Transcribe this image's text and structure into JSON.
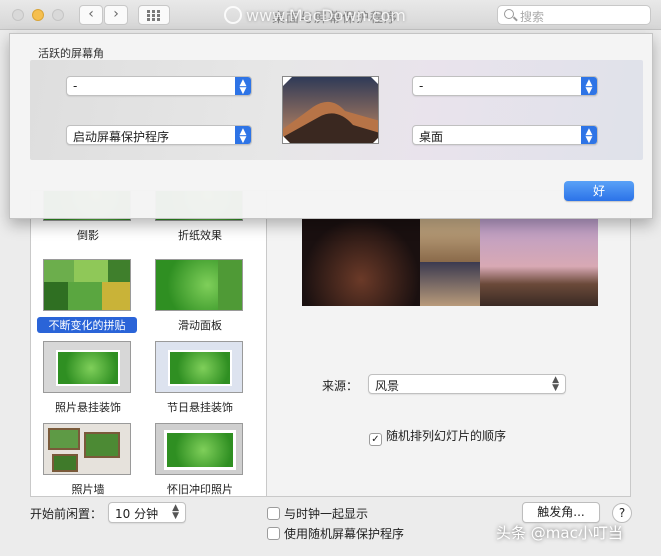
{
  "window": {
    "title": "桌面与屏幕保护程序",
    "search_placeholder": "搜索"
  },
  "watermark": "www.MacDown.com",
  "hot_corners": {
    "title": "活跃的屏幕角",
    "top_left": "-",
    "top_right": "-",
    "bottom_left": "启动屏幕保护程序",
    "bottom_right": "桌面",
    "ok_label": "好"
  },
  "screensavers": [
    {
      "name": "倒影",
      "selected": false
    },
    {
      "name": "折纸效果",
      "selected": false
    },
    {
      "name": "不断变化的拼贴",
      "selected": true
    },
    {
      "name": "滑动面板",
      "selected": false
    },
    {
      "name": "照片悬挂装饰",
      "selected": false
    },
    {
      "name": "节日悬挂装饰",
      "selected": false
    },
    {
      "name": "照片墙",
      "selected": false
    },
    {
      "name": "怀旧冲印照片",
      "selected": false
    }
  ],
  "options": {
    "source_label": "来源：",
    "source_value": "风景",
    "shuffle_label": "随机排列幻灯片的顺序",
    "shuffle_checked": true
  },
  "footer": {
    "idle_label": "开始前闲置：",
    "idle_value": "10 分钟",
    "show_clock_label": "与时钟一起显示",
    "random_saver_label": "使用随机屏幕保护程序",
    "hot_corners_button": "触发角...",
    "help": "?",
    "source_mark": "头条 @mac小叮当"
  },
  "colors": {
    "accent": "#2e74e6",
    "selection": "#2a64d8"
  }
}
